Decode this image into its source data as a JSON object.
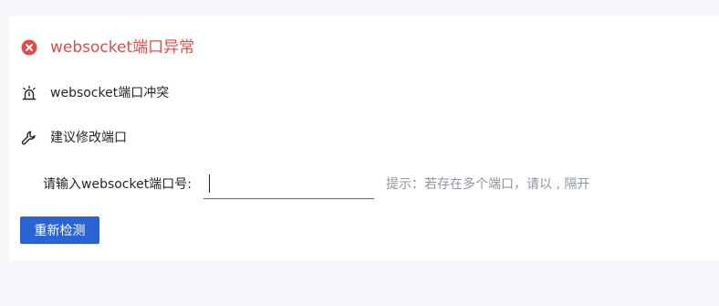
{
  "error": {
    "icon": "close-circle-icon",
    "title": "websocket端口异常",
    "color": "#e24a4a"
  },
  "conflict": {
    "icon": "alarm-light-icon",
    "text": "websocket端口冲突"
  },
  "suggestion": {
    "icon": "wrench-icon",
    "text": "建议修改端口"
  },
  "port_input": {
    "label": "请输入websocket端口号:",
    "value": "",
    "hint": "提示：若存在多个端口，请以 , 隔开"
  },
  "actions": {
    "recheck_label": "重新检测",
    "primary_color": "#2a63d6"
  }
}
